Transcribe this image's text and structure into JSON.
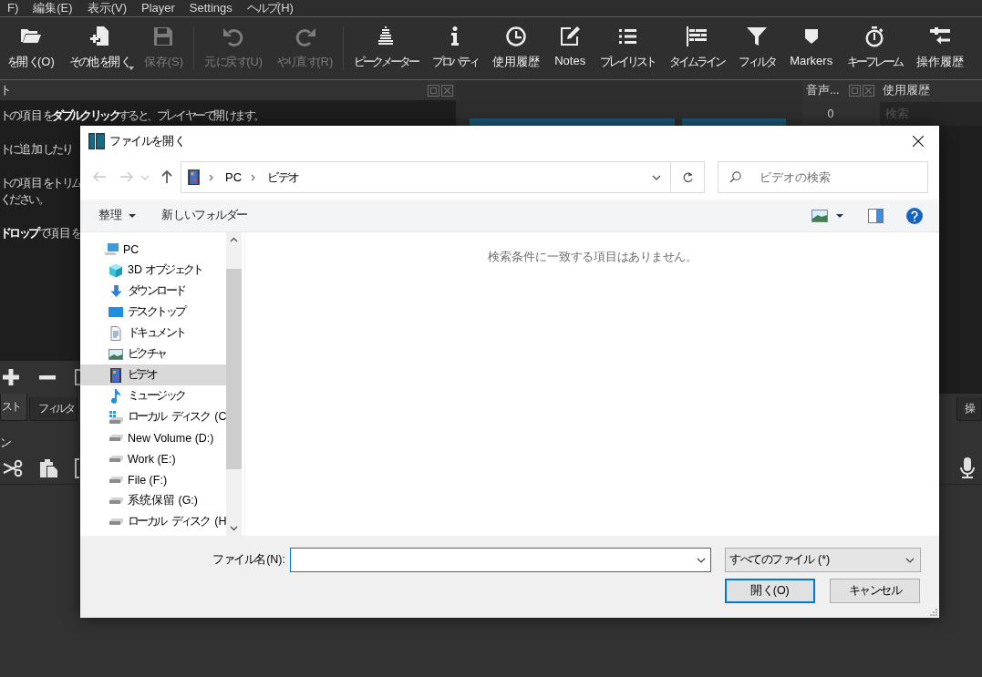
{
  "menu_bar": {
    "items": [
      "F)",
      "編集(E)",
      "表示(V)",
      "Player",
      "Settings",
      "ヘルプ(H)"
    ]
  },
  "toolbar": {
    "groups": [
      {
        "items": [
          {
            "label": "を開く(O)",
            "disabled": false,
            "has_menu": false
          },
          {
            "label": "その他を開く",
            "disabled": false,
            "has_menu": true
          },
          {
            "label": "保存(S)",
            "disabled": true,
            "has_menu": false
          }
        ]
      },
      {
        "items": [
          {
            "label": "元に戻す(U)",
            "disabled": true,
            "has_menu": false
          },
          {
            "label": "やり直す(R)",
            "disabled": true,
            "has_menu": false
          }
        ]
      },
      {
        "items": [
          {
            "label": "ピークメーター",
            "disabled": false,
            "has_menu": false
          },
          {
            "label": "プロパティ",
            "disabled": false,
            "has_menu": false
          },
          {
            "label": "使用履歴",
            "disabled": false,
            "has_menu": false
          },
          {
            "label": "Notes",
            "disabled": false,
            "has_menu": false
          },
          {
            "label": "プレイリスト",
            "disabled": false,
            "has_menu": false
          },
          {
            "label": "タイムライン",
            "disabled": false,
            "has_menu": false
          },
          {
            "label": "フィルタ",
            "disabled": false,
            "has_menu": false
          },
          {
            "label": "Markers",
            "disabled": false,
            "has_menu": false
          },
          {
            "label": "キーフレーム",
            "disabled": false,
            "has_menu": false
          },
          {
            "label": "操作履歴",
            "disabled": false,
            "has_menu": false
          }
        ]
      }
    ]
  },
  "playlist_panel": {
    "title": "ト",
    "paragraphs": [
      {
        "lines": [
          "トの項目を**ダブルクリック**すると、プレイヤーで開けます。"
        ]
      },
      {
        "lines": [
          "トに追加したり"
        ]
      },
      {
        "lines": [
          "トの項目をトリム",
          "ください。"
        ]
      },
      {
        "lines": [
          "**ドロップ**で項目を"
        ]
      }
    ]
  },
  "audio_panel": {
    "title": "音声...",
    "reading": "0"
  },
  "recent_panel": {
    "title": "使用履歴",
    "search": {
      "placeholder": "検索"
    }
  },
  "dock_tabs": {
    "left": [
      {
        "label": "スト",
        "selected": true
      },
      {
        "label": "フィルタ",
        "selected": false
      }
    ],
    "right": [
      {
        "label": "操",
        "selected": false
      }
    ]
  },
  "timeline_panel": {
    "title": "ン"
  },
  "dialog": {
    "title": "ファイルを開く",
    "nav_buttons": [
      {
        "disabled": true
      },
      {
        "disabled": true
      },
      {
        "disabled": true
      },
      {
        "disabled": false
      }
    ],
    "address": {
      "segments": [
        "PC",
        "ビデオ"
      ]
    },
    "search": {
      "placeholder": "ビデオの検索"
    },
    "commands": [
      {
        "label": "整理",
        "has_menu": true
      },
      {
        "label": "新しいフォルダー",
        "has_menu": false
      }
    ],
    "nav_tree": [
      {
        "label": "PC",
        "selected": false,
        "children": [
          {
            "label": "3D オブジェクト",
            "selected": false
          },
          {
            "label": "ダウンロード",
            "selected": false
          },
          {
            "label": "デスクトップ",
            "selected": false
          },
          {
            "label": "ドキュメント",
            "selected": false
          },
          {
            "label": "ピクチャ",
            "selected": false
          },
          {
            "label": "ビデオ",
            "selected": true
          },
          {
            "label": "ミュージック",
            "selected": false
          },
          {
            "label": "ローカル ディスク (C",
            "selected": false
          },
          {
            "label": "New Volume (D:)",
            "selected": false
          },
          {
            "label": "Work (E:)",
            "selected": false
          },
          {
            "label": "File (F:)",
            "selected": false
          },
          {
            "label": "系统保留 (G:)",
            "selected": false
          },
          {
            "label": "ローカル ディスク (H",
            "selected": false
          }
        ]
      }
    ],
    "empty_message": "検索条件に一致する項目はありません。",
    "file_name": {
      "label": "ファイル名(N):"
    },
    "file_type": {
      "value": "すべてのファイル (*)"
    },
    "buttons": [
      {
        "label": "開く(O)",
        "default": true
      },
      {
        "label": "キャンセル",
        "default": false
      }
    ]
  }
}
